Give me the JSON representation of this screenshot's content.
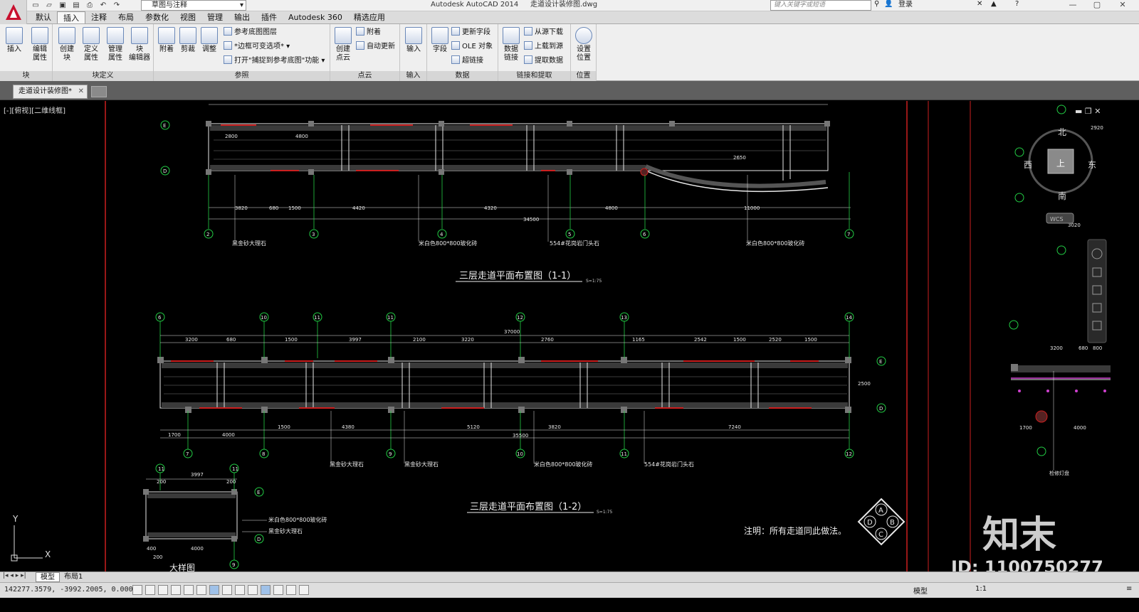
{
  "titlebar": {
    "workspace": "草图与注释",
    "app_title": "Autodesk AutoCAD 2014",
    "file_title": "走道设计装修图.dwg",
    "search_placeholder": "键入关键字或短语",
    "login": "登录"
  },
  "ribbon_tabs": [
    "默认",
    "插入",
    "注释",
    "布局",
    "参数化",
    "视图",
    "管理",
    "输出",
    "插件",
    "Autodesk 360",
    "精选应用"
  ],
  "active_tab": "插入",
  "panels": {
    "block": {
      "title": "块",
      "insert": "插入",
      "edit_attr": "编辑\n属性"
    },
    "block_def": {
      "title": "块定义",
      "create": "创建\n块",
      "define_attr": "定义\n属性",
      "manage_attr": "管理\n属性",
      "block_editor": "块\n编辑器"
    },
    "reference": {
      "title": "参照",
      "attach": "附着",
      "clip": "剪裁",
      "adjust": "调整",
      "ref_layers": "参考底图图层",
      "frame_var": "*边框可变选项*",
      "snap": "打开\"捕捉到参考底图\"功能"
    },
    "pointcloud": {
      "title": "点云",
      "create": "创建\n点云",
      "attach": "附着",
      "auto_update": "自动更新"
    },
    "import": {
      "title": "输入",
      "import": "输入"
    },
    "data": {
      "title": "数据",
      "field": "字段",
      "update_fields": "更新字段",
      "ole": "OLE 对象",
      "hyperlink": "超链接"
    },
    "linking": {
      "title": "链接和提取",
      "data_link": "数据\n链接",
      "download": "从源下载",
      "upload": "上载到源",
      "extract": "提取数据"
    },
    "location": {
      "title": "位置",
      "set_location": "设置\n位置"
    }
  },
  "file_tab": "走道设计装修图*",
  "viewport_label": "[-][俯视][二维线框]",
  "viewcube": {
    "north": "北",
    "south": "南",
    "east": "东",
    "west": "西",
    "top": "上",
    "wcs": "WCS"
  },
  "drawing": {
    "title1": "三层走道平面布置图（1-1）",
    "title2": "三层走道平面布置图（1-2）",
    "detail_title": "大样图",
    "scale_note": "S=1:75",
    "note": "注明：所有走道同此做法。",
    "materials": [
      "黑金砂大理石",
      "米白色800*800玻化砖",
      "554#花岗岩门头石",
      "米白色800*800玻化砖"
    ],
    "dim_top_total": "34500",
    "dim_mid_total": "37000",
    "dim_mid_bottom_total": "35500",
    "dim_detail": "3997",
    "compass": [
      "A",
      "B",
      "C",
      "D"
    ]
  },
  "layout_tabs": [
    "模型",
    "布局1"
  ],
  "status": {
    "coords": "142277.3579, -3992.2005, 0.0000",
    "model": "模型",
    "scale": "1:1"
  },
  "watermark": {
    "brand": "知末",
    "id": "ID: 1100750277"
  },
  "colors": {
    "accent_red": "#e03030",
    "dim_green": "#22cc44",
    "line_white": "#e8e8e8",
    "wall_red": "#cc1f1f"
  }
}
